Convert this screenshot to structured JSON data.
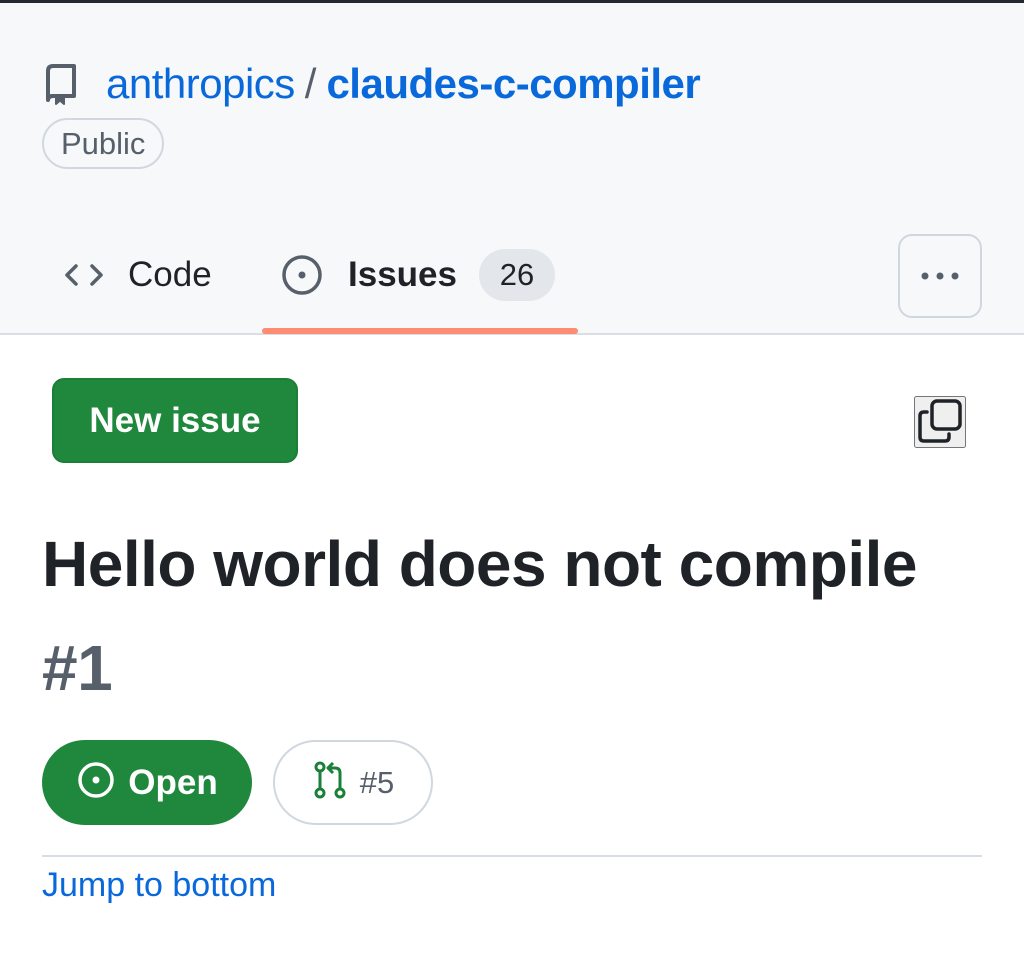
{
  "repo": {
    "owner": "anthropics",
    "separator": "/",
    "name": "claudes-c-compiler",
    "visibility": "Public",
    "icon": "repo-icon"
  },
  "tabs": [
    {
      "label": "Code",
      "icon": "code-icon",
      "selected": false
    },
    {
      "label": "Issues",
      "icon": "issue-opened-icon",
      "counter": "26",
      "selected": true
    }
  ],
  "header_actions": {
    "more_icon": "kebab-horizontal-icon"
  },
  "actions": {
    "new_issue_label": "New issue",
    "copy_icon": "copy-icon"
  },
  "issue": {
    "title": "Hello world does not compile",
    "number": "#1",
    "state": "Open",
    "linked_pr": "#5"
  },
  "links": {
    "jump_to_bottom": "Jump to bottom"
  },
  "colors": {
    "link_blue": "#0969da",
    "success_green": "#1f883d",
    "tab_underline": "#fd8c73",
    "header_bg": "#f6f8fa",
    "muted_text": "#57606a"
  }
}
